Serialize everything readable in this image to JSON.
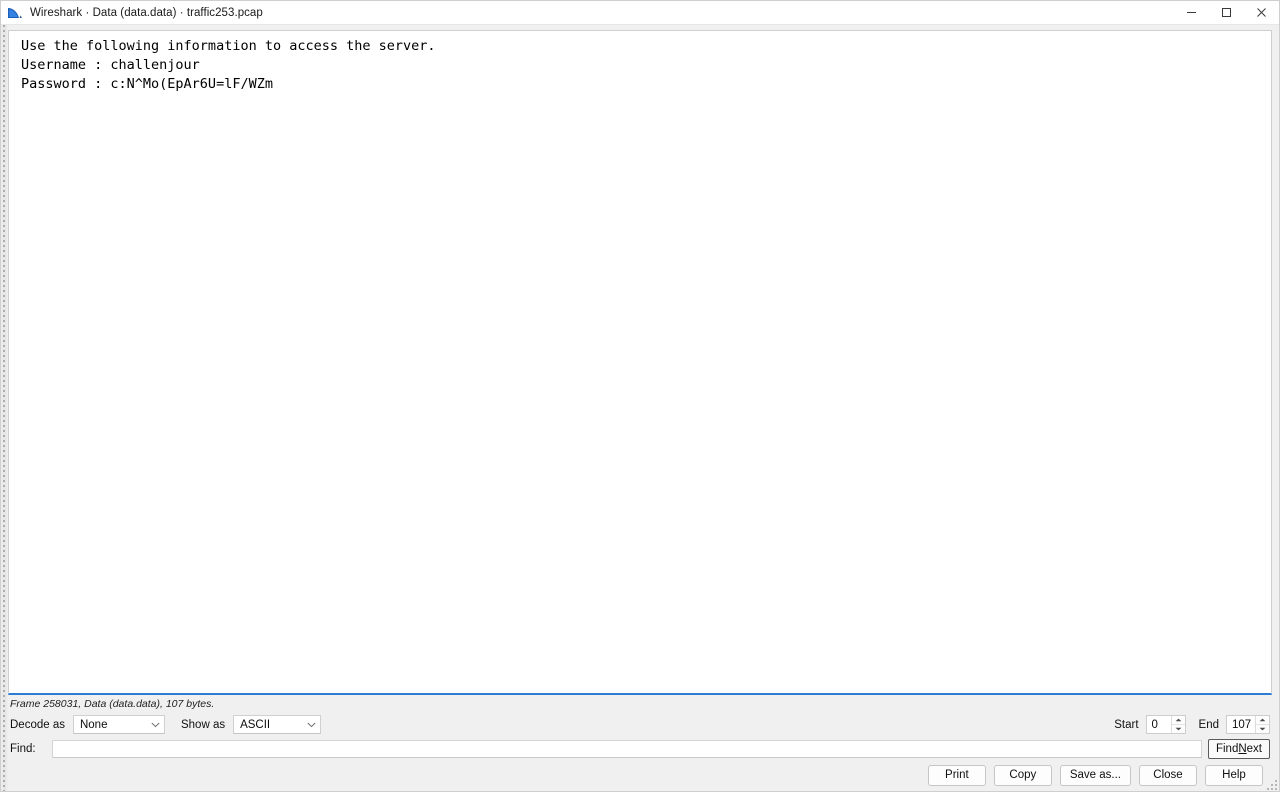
{
  "window": {
    "title": "Wireshark · Data (data.data) · traffic253.pcap",
    "app_icon": "wireshark-fin-icon",
    "controls": {
      "minimize": "minimize-icon",
      "maximize": "maximize-icon",
      "close": "close-icon"
    },
    "accent_color": "#2b7cd3",
    "chrome_color": "#f0f0f0",
    "pane_color": "#ffffff"
  },
  "content": {
    "lines": [
      "Use the following information to access the server.",
      "Username : challenjour",
      "Password : c:N^Mo(EpAr6U=lF/WZm"
    ],
    "text": "Use the following information to access the server.\nUsername : challenjour\nPassword : c:N^Mo(EpAr6U=lF/WZm"
  },
  "status": {
    "text": "Frame 258031, Data (data.data), 107 bytes.",
    "frame": "258031",
    "source": "Data (data.data)",
    "bytes": "107 bytes"
  },
  "controls": {
    "decode_as_label": "Decode as",
    "decode_as_value": "None",
    "decode_as_options": [
      "None"
    ],
    "show_as_label": "Show as",
    "show_as_value": "ASCII",
    "show_as_options": [
      "ASCII"
    ],
    "start_label": "Start",
    "start_value": "0",
    "end_label": "End",
    "end_value": "107"
  },
  "find": {
    "label": "Find:",
    "value": "",
    "placeholder": "",
    "button_prefix": "Find ",
    "button_mnemonic": "N",
    "button_suffix": "ext",
    "button_label": "Find Next"
  },
  "buttons": {
    "print": "Print",
    "copy": "Copy",
    "save_as": "Save as...",
    "close": "Close",
    "help": "Help"
  }
}
